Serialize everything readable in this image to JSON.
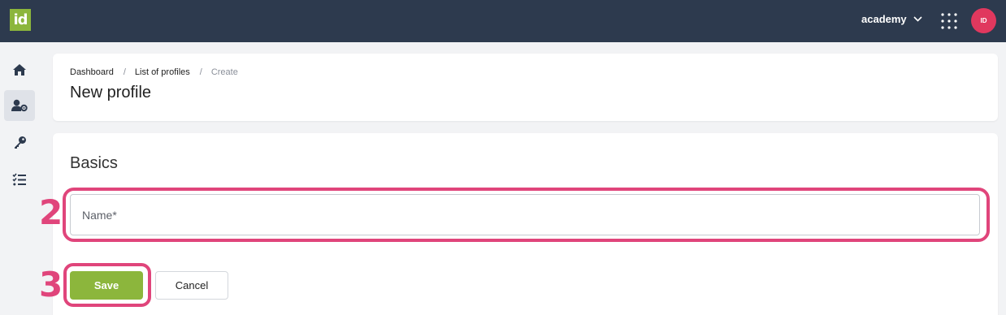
{
  "header": {
    "logo_text": "id",
    "account_label": "academy",
    "account_chevron_icon": "chevron-down-icon",
    "apps_icon": "grid-dots-icon",
    "avatar_initials": "ID",
    "colors": {
      "bar": "#2d3a4e",
      "logo": "#8cb63c",
      "avatar": "#e0385e"
    }
  },
  "sidebar": {
    "items": [
      {
        "icon": "home-icon",
        "active": false
      },
      {
        "icon": "user-settings-icon",
        "active": true
      },
      {
        "icon": "key-icon",
        "active": false
      },
      {
        "icon": "checklist-icon",
        "active": false
      }
    ]
  },
  "breadcrumb": {
    "items": [
      "Dashboard",
      "List of profiles",
      "Create"
    ],
    "separator": "/"
  },
  "page": {
    "title": "New profile"
  },
  "form": {
    "section_title": "Basics",
    "name_field": {
      "placeholder": "Name*",
      "value": ""
    },
    "save_label": "Save",
    "cancel_label": "Cancel"
  },
  "annotations": {
    "step_input": "2",
    "step_save": "3",
    "color": "#e0457b"
  }
}
